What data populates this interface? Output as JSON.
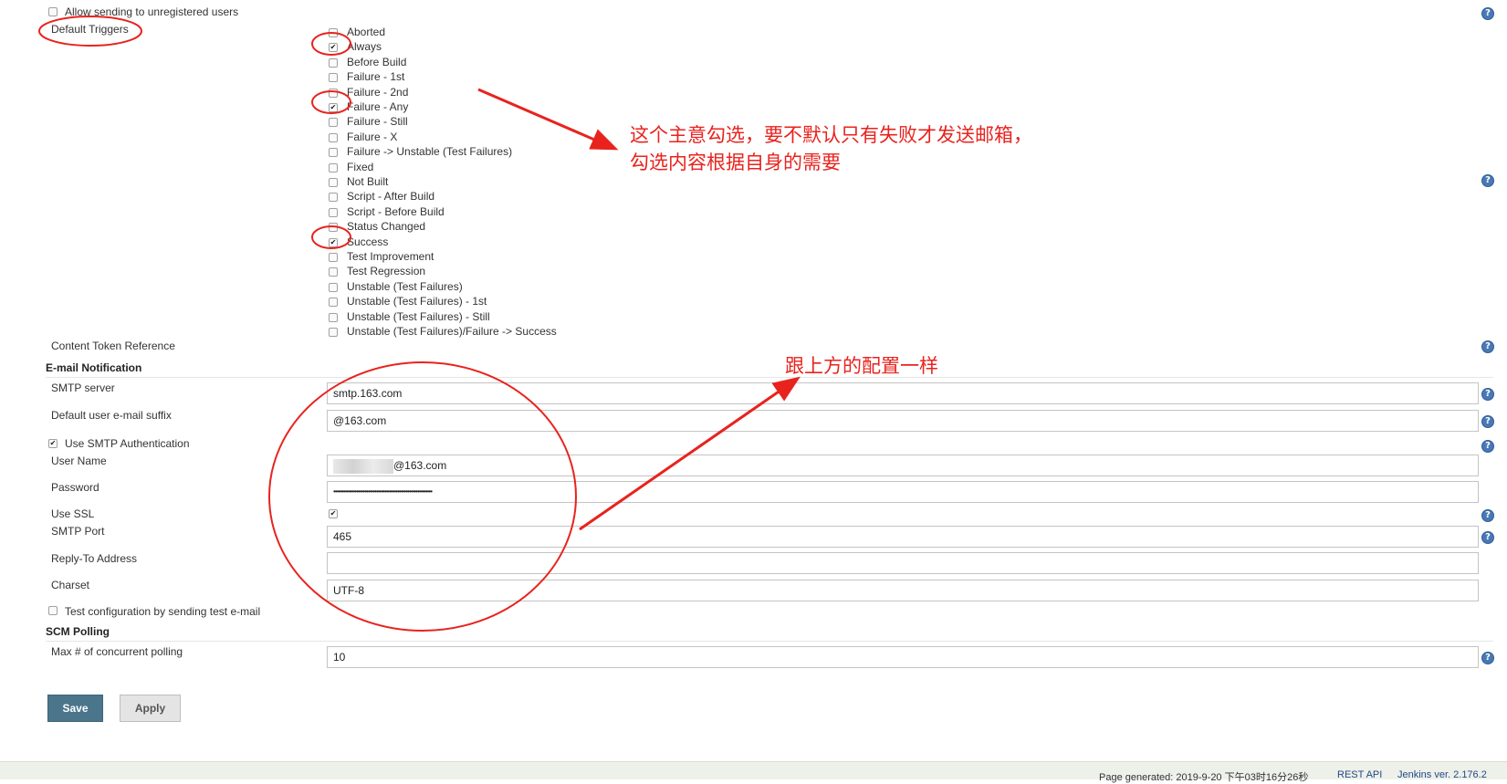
{
  "top": {
    "allow_unregistered_label": "Allow sending to unregistered users",
    "default_triggers_label": "Default Triggers"
  },
  "triggers": [
    {
      "label": "Aborted",
      "checked": false
    },
    {
      "label": "Always",
      "checked": true
    },
    {
      "label": "Before Build",
      "checked": false
    },
    {
      "label": "Failure - 1st",
      "checked": false
    },
    {
      "label": "Failure - 2nd",
      "checked": false
    },
    {
      "label": "Failure - Any",
      "checked": true
    },
    {
      "label": "Failure - Still",
      "checked": false
    },
    {
      "label": "Failure - X",
      "checked": false
    },
    {
      "label": "Failure -> Unstable (Test Failures)",
      "checked": false
    },
    {
      "label": "Fixed",
      "checked": false
    },
    {
      "label": "Not Built",
      "checked": false
    },
    {
      "label": "Script - After Build",
      "checked": false
    },
    {
      "label": "Script - Before Build",
      "checked": false
    },
    {
      "label": "Status Changed",
      "checked": false
    },
    {
      "label": "Success",
      "checked": true
    },
    {
      "label": "Test Improvement",
      "checked": false
    },
    {
      "label": "Test Regression",
      "checked": false
    },
    {
      "label": "Unstable (Test Failures)",
      "checked": false
    },
    {
      "label": "Unstable (Test Failures) - 1st",
      "checked": false
    },
    {
      "label": "Unstable (Test Failures) - Still",
      "checked": false
    },
    {
      "label": "Unstable (Test Failures)/Failure -> Success",
      "checked": false
    }
  ],
  "content_token_reference": "Content Token Reference",
  "email": {
    "section_title": "E-mail Notification",
    "smtp_server_label": "SMTP server",
    "smtp_server_value": "smtp.163.com",
    "suffix_label": "Default user e-mail suffix",
    "suffix_value": "@163.com",
    "use_auth_label": "Use SMTP Authentication",
    "use_auth_checked": true,
    "username_label": "User Name",
    "username_value": "@163.com",
    "password_label": "Password",
    "password_value": "••••••••••••••••••••••••••••••••••••••••••••••••••••••••••••",
    "ssl_label": "Use SSL",
    "ssl_checked": true,
    "port_label": "SMTP Port",
    "port_value": "465",
    "reply_to_label": "Reply-To Address",
    "reply_to_value": "",
    "charset_label": "Charset",
    "charset_value": "UTF-8",
    "test_config_label": "Test configuration by sending test e-mail"
  },
  "scm": {
    "section_title": "SCM Polling",
    "max_label": "Max # of concurrent polling",
    "max_value": "10"
  },
  "buttons": {
    "save": "Save",
    "apply": "Apply"
  },
  "annotations": {
    "note1_line1": "这个主意勾选，要不默认只有失败才发送邮箱，",
    "note1_line2": "勾选内容根据自身的需要",
    "note2": "跟上方的配置一样"
  },
  "footer": {
    "generated": "Page generated: 2019-9-20 下午03时16分26秒",
    "rest_api": "REST API",
    "version": "Jenkins ver. 2.176.2"
  },
  "colors": {
    "annotation_red": "#e8231e",
    "save_button": "#4b758b",
    "link_blue": "#204a87"
  }
}
